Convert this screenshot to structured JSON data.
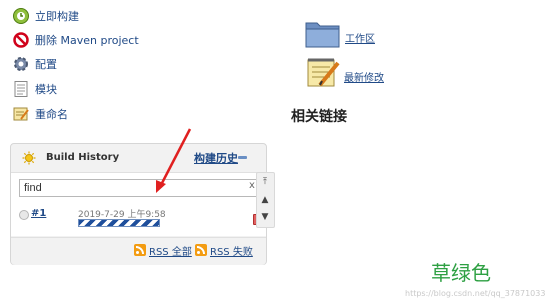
{
  "sidebar": {
    "items": [
      {
        "label": "立即构建",
        "icon": "build-clock-icon"
      },
      {
        "label": "删除 Maven project",
        "icon": "no-entry-icon"
      },
      {
        "label": "配置",
        "icon": "gear-icon"
      },
      {
        "label": "模块",
        "icon": "document-icon"
      },
      {
        "label": "重命名",
        "icon": "notepad-icon"
      }
    ]
  },
  "main": {
    "workspace_label": "工作区",
    "changes_label": "最新修改",
    "related_links_title": "相关链接"
  },
  "build_history": {
    "title": "Build History",
    "trend_label": "构建历史",
    "search_value": "find",
    "clear_label": "x",
    "builds": [
      {
        "number": "#1",
        "timestamp": "2019-7-29 上午9:58"
      }
    ],
    "rss_all": "RSS 全部",
    "rss_failed": "RSS 失败"
  },
  "annotation": {
    "caption": "草绿色",
    "watermark": "https://blog.csdn.net/qq_37871033"
  },
  "colors": {
    "link": "#204a87",
    "arrow": "#e02020",
    "caption": "#2ea043",
    "rss": "#f39c12"
  }
}
